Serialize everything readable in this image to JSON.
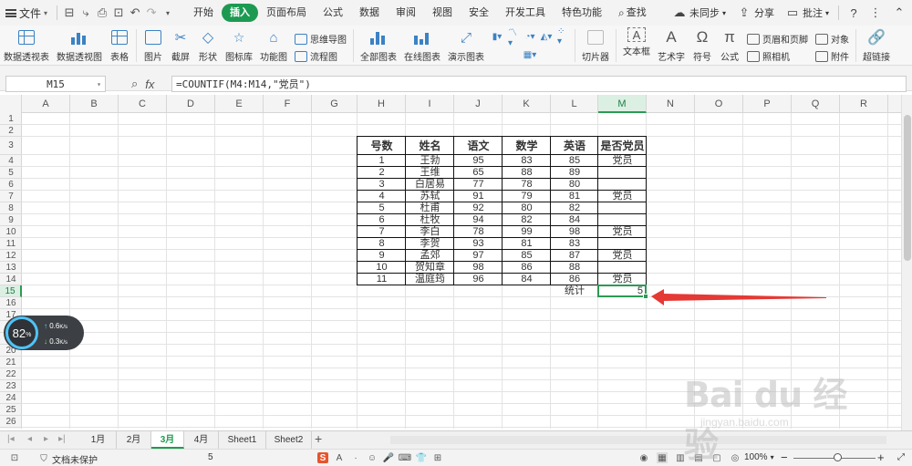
{
  "menubar": {
    "file": "文件",
    "tabs": [
      "开始",
      "插入",
      "页面布局",
      "公式",
      "数据",
      "审阅",
      "视图",
      "安全",
      "开发工具",
      "特色功能"
    ],
    "active_tab": "插入",
    "search": "查找",
    "sync": "未同步",
    "share": "分享",
    "comment": "批注"
  },
  "ribbon": {
    "pivot_table": "数据透视表",
    "pivot_chart": "数据透视图",
    "table": "表格",
    "picture": "图片",
    "screenshot": "截屏",
    "shape": "形状",
    "icon_lib": "图标库",
    "func_chart": "功能图",
    "mindmap": "思维导图",
    "flowchart": "流程图",
    "all_charts": "全部图表",
    "online_chart": "在线图表",
    "demo_chart": "演示图表",
    "slicer": "切片器",
    "textbox": "文本框",
    "wordart": "艺术字",
    "symbol": "符号",
    "formula": "公式",
    "header_footer": "页眉和页脚",
    "camera": "照相机",
    "object": "对象",
    "attachment": "附件",
    "hyperlink": "超链接"
  },
  "formula_bar": {
    "cell_ref": "M15",
    "fx": "fx",
    "formula": "=COUNTIF(M4:M14,\"党员\")"
  },
  "columns": [
    "A",
    "B",
    "C",
    "D",
    "E",
    "F",
    "G",
    "H",
    "I",
    "J",
    "K",
    "L",
    "M",
    "N",
    "O",
    "P",
    "Q",
    "R"
  ],
  "selected_column": "M",
  "rows": [
    "1",
    "2",
    "3",
    "4",
    "5",
    "6",
    "7",
    "8",
    "9",
    "10",
    "11",
    "12",
    "13",
    "14",
    "15",
    "16",
    "17",
    "18",
    "19",
    "20",
    "21",
    "22",
    "23",
    "24",
    "25",
    "26"
  ],
  "selected_row": "15",
  "table": {
    "headers": [
      "号数",
      "姓名",
      "语文",
      "数学",
      "英语",
      "是否党员"
    ],
    "rows": [
      [
        "1",
        "王勃",
        "95",
        "83",
        "85",
        "党员"
      ],
      [
        "2",
        "王维",
        "65",
        "88",
        "89",
        ""
      ],
      [
        "3",
        "白居易",
        "77",
        "78",
        "80",
        ""
      ],
      [
        "4",
        "苏轼",
        "91",
        "79",
        "81",
        "党员"
      ],
      [
        "5",
        "杜甫",
        "92",
        "80",
        "82",
        ""
      ],
      [
        "6",
        "杜牧",
        "94",
        "82",
        "84",
        ""
      ],
      [
        "7",
        "李白",
        "78",
        "99",
        "98",
        "党员"
      ],
      [
        "8",
        "李贺",
        "93",
        "81",
        "83",
        ""
      ],
      [
        "9",
        "孟郊",
        "97",
        "85",
        "87",
        "党员"
      ],
      [
        "10",
        "贺知章",
        "98",
        "86",
        "88",
        ""
      ],
      [
        "11",
        "温庭筠",
        "96",
        "84",
        "86",
        "党员"
      ]
    ],
    "stat_label": "统计",
    "stat_value": "5"
  },
  "speed_widget": {
    "percent": "82",
    "percent_unit": "%",
    "up": "0.6",
    "down": "0.3",
    "unit": "K/s"
  },
  "sheets": [
    "1月",
    "2月",
    "3月",
    "4月",
    "Sheet1",
    "Sheet2"
  ],
  "active_sheet": "3月",
  "status": {
    "protect": "文档未保护",
    "value": "5",
    "zoom": "100%"
  },
  "watermark": {
    "main": "Bai du 经验",
    "sub": "jingyan.baidu.com"
  },
  "colors": {
    "accent": "#1d9a52",
    "arrow": "#e53935"
  }
}
